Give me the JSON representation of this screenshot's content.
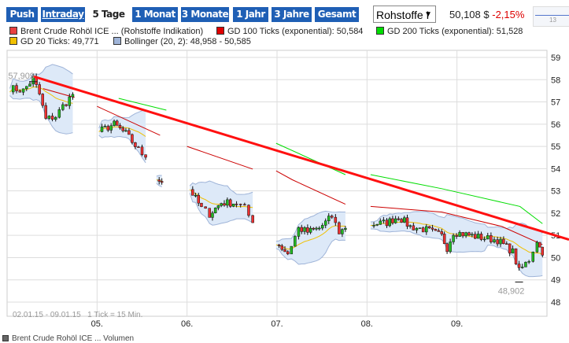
{
  "toolbar": {
    "buttons": [
      {
        "label": "Push",
        "state": "normal"
      },
      {
        "label": "Intraday",
        "state": "underline"
      },
      {
        "label": "5 Tage",
        "state": "selected"
      },
      {
        "label": "1 Monat",
        "state": "normal"
      },
      {
        "label": "3 Monate",
        "state": "normal"
      },
      {
        "label": "1 Jahr",
        "state": "normal"
      },
      {
        "label": "3 Jahre",
        "state": "normal"
      },
      {
        "label": "Gesamt",
        "state": "normal"
      }
    ],
    "select_value": "Rohstoffe I",
    "price": "50,108 $",
    "change": "-2,15%",
    "mini_label": "13"
  },
  "legend": [
    {
      "label": "Brent Crude Rohöl ICE ... (Rohstoffe Indikation)",
      "color": "#e84040"
    },
    {
      "label": "GD 100 Ticks (exponential): 50,584",
      "color": "#e00000"
    },
    {
      "label": "GD 200 Ticks (exponential): 51,528",
      "color": "#00dd00"
    },
    {
      "label": "GD 20 Ticks: 49,771",
      "color": "#f0c000"
    },
    {
      "label": "Bollinger (20, 2): 48,958 - 50,585",
      "color": "#9fb4d8"
    }
  ],
  "footer": {
    "range": "02.01.15 - 09.01.15",
    "tick": "1 Tick = 15 Min.",
    "volume_legend": "Brent Crude Rohöl ICE ... Volumen"
  },
  "chart_data": {
    "type": "candlestick",
    "ylim": [
      48,
      59
    ],
    "yticks": [
      "48",
      "49",
      "50",
      "51",
      "52",
      "53",
      "54",
      "55",
      "56",
      "57",
      "58",
      "59"
    ],
    "xlim": [
      4.0,
      10.0
    ],
    "xticks": [
      {
        "v": 5,
        "label": "05."
      },
      {
        "v": 6,
        "label": "06."
      },
      {
        "v": 7,
        "label": "07."
      },
      {
        "v": 8,
        "label": "08."
      },
      {
        "v": 9,
        "label": "09."
      }
    ],
    "grid": true,
    "annotations": [
      {
        "x": 4.29,
        "y": 57.909,
        "label": "57,909"
      },
      {
        "x": 9.69,
        "y": 48.902,
        "label": "48,902"
      }
    ],
    "price_sessions": [
      [
        [
          4.03,
          57.62
        ],
        [
          4.18,
          57.51
        ],
        [
          4.29,
          58.04
        ],
        [
          4.36,
          57.34
        ],
        [
          4.43,
          56.21
        ],
        [
          4.54,
          56.35
        ],
        [
          4.62,
          56.81
        ],
        [
          4.73,
          57.34
        ]
      ],
      [
        [
          5.02,
          55.67
        ],
        [
          5.19,
          55.99
        ],
        [
          5.32,
          55.57
        ],
        [
          5.46,
          54.86
        ],
        [
          5.54,
          54.51
        ]
      ],
      [
        [
          5.66,
          53.62
        ],
        [
          5.72,
          53.38
        ]
      ],
      [
        [
          6.03,
          53.09
        ],
        [
          6.16,
          52.21
        ],
        [
          6.25,
          51.96
        ],
        [
          6.38,
          52.46
        ],
        [
          6.55,
          52.46
        ],
        [
          6.64,
          52.21
        ],
        [
          6.73,
          51.57
        ]
      ],
      [
        [
          6.99,
          50.69
        ],
        [
          7.12,
          50.19
        ],
        [
          7.24,
          51.32
        ],
        [
          7.34,
          51.15
        ],
        [
          7.47,
          51.32
        ],
        [
          7.61,
          51.85
        ],
        [
          7.69,
          51.15
        ],
        [
          7.76,
          51.32
        ]
      ],
      [
        [
          8.04,
          51.5
        ],
        [
          8.22,
          51.57
        ],
        [
          8.35,
          51.85
        ],
        [
          8.48,
          51.39
        ],
        [
          8.66,
          51.25
        ],
        [
          8.83,
          50.97
        ],
        [
          8.89,
          50.44
        ],
        [
          8.96,
          51.15
        ],
        [
          9.1,
          51.04
        ],
        [
          9.27,
          50.9
        ],
        [
          9.45,
          50.79
        ],
        [
          9.62,
          50.26
        ],
        [
          9.69,
          49.38
        ],
        [
          9.8,
          49.91
        ],
        [
          9.89,
          50.79
        ],
        [
          9.95,
          50.108
        ]
      ]
    ],
    "gd100": [
      [
        [
          4.4,
          57.6
        ],
        [
          4.75,
          57.2
        ]
      ],
      [
        [
          5.0,
          56.8
        ],
        [
          5.7,
          55.5
        ]
      ],
      [
        [
          6.0,
          55.0
        ],
        [
          6.73,
          53.98
        ]
      ],
      [
        [
          6.99,
          53.9
        ],
        [
          7.17,
          53.5
        ],
        [
          7.76,
          52.4
        ]
      ],
      [
        [
          8.04,
          52.3
        ],
        [
          8.83,
          52.05
        ],
        [
          9.5,
          51.4
        ],
        [
          9.95,
          50.584
        ]
      ]
    ],
    "gd200": [
      [
        [
          5.24,
          57.16
        ],
        [
          5.77,
          56.63
        ]
      ],
      [
        [
          6.99,
          55.14
        ],
        [
          7.76,
          53.73
        ]
      ],
      [
        [
          8.04,
          53.73
        ],
        [
          8.83,
          53.1
        ],
        [
          9.7,
          52.3
        ],
        [
          9.95,
          51.528
        ]
      ]
    ],
    "trendline": [
      [
        4.29,
        58.15
      ],
      [
        10.26,
        50.79
      ]
    ],
    "colors": {
      "up": "#22bb22",
      "down": "#ee3030",
      "trend": "#ff1010",
      "gd100": "#cc0000",
      "gd200": "#00dd00",
      "gd20": "#f0c000",
      "band": "#dde9f8",
      "band_edge": "#9fb4d8"
    }
  }
}
